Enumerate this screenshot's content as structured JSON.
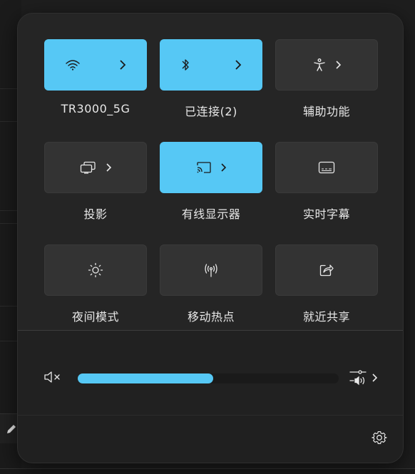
{
  "quick_settings": {
    "tiles": [
      {
        "id": "wifi",
        "label": "TR3000_5G",
        "active": true,
        "icon": "wifi-icon",
        "has_chevron": true
      },
      {
        "id": "bluetooth",
        "label": "已连接(2)",
        "active": true,
        "icon": "bluetooth-icon",
        "has_chevron": true
      },
      {
        "id": "accessibility",
        "label": "辅助功能",
        "active": false,
        "icon": "accessibility-icon",
        "has_chevron": true
      },
      {
        "id": "project",
        "label": "投影",
        "active": false,
        "icon": "project-icon",
        "has_chevron": true
      },
      {
        "id": "cast",
        "label": "有线显示器",
        "active": true,
        "icon": "cast-icon",
        "has_chevron": true
      },
      {
        "id": "captions",
        "label": "实时字幕",
        "active": false,
        "icon": "captions-icon",
        "has_chevron": false
      },
      {
        "id": "night_light",
        "label": "夜间模式",
        "active": false,
        "icon": "brightness-icon",
        "has_chevron": false
      },
      {
        "id": "hotspot",
        "label": "移动热点",
        "active": false,
        "icon": "hotspot-icon",
        "has_chevron": false
      },
      {
        "id": "nearby_share",
        "label": "就近共享",
        "active": false,
        "icon": "share-icon",
        "has_chevron": false
      }
    ]
  },
  "volume": {
    "muted": true,
    "level_fraction": 0.52,
    "mute_icon": "speaker-muted-icon",
    "output_icon": "audio-output-icon"
  },
  "footer": {
    "settings_icon": "gear-icon"
  },
  "colors": {
    "accent": "#56c8f5",
    "tile_off": "#333333",
    "panel": "#252525"
  }
}
